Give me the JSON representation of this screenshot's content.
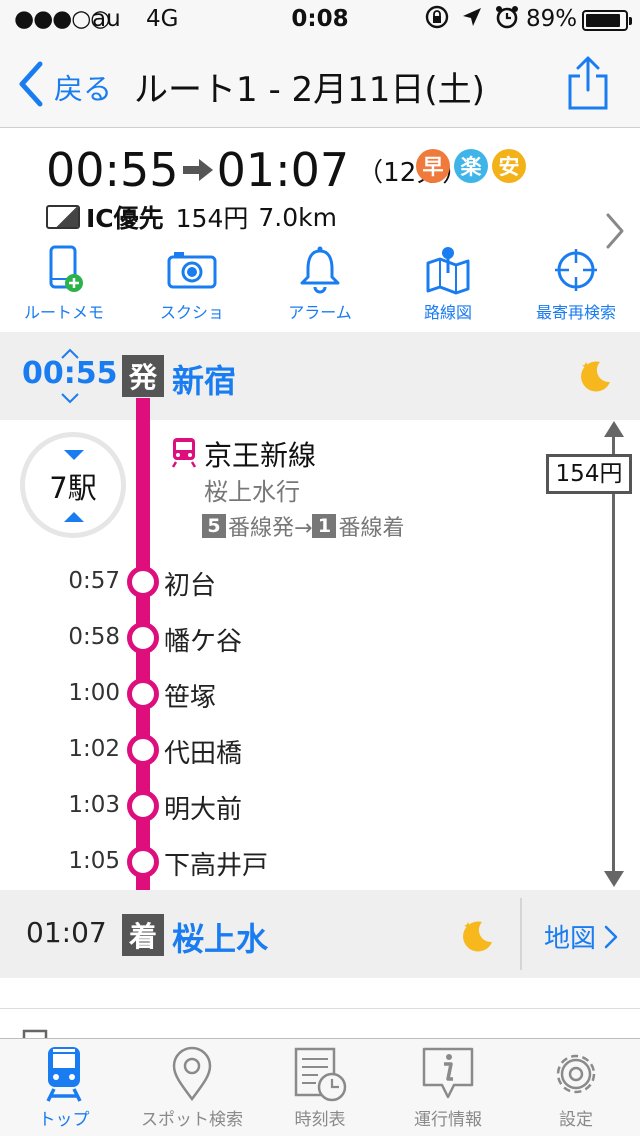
{
  "status_bar": {
    "signal": "●●●○○",
    "carrier": "au",
    "network": "4G",
    "time": "0:08",
    "battery_text": "89%",
    "battery_level": 0.89
  },
  "nav": {
    "back_label": "戻る",
    "title": "ルート1 - 2月11日(土)"
  },
  "summary": {
    "depart": "00:55",
    "arrive": "01:07",
    "duration": "（12分）",
    "badges": [
      {
        "label": "早",
        "color": "#f07a3c"
      },
      {
        "label": "楽",
        "color": "#3fb4e8"
      },
      {
        "label": "安",
        "color": "#f3b21a"
      }
    ],
    "ic_label": "IC優先",
    "fare": "154円",
    "distance": "7.0km"
  },
  "actions": [
    {
      "label": "ルートメモ",
      "icon": "phone-add-icon"
    },
    {
      "label": "スクショ",
      "icon": "camera-icon"
    },
    {
      "label": "アラーム",
      "icon": "bell-icon"
    },
    {
      "label": "路線図",
      "icon": "map-pin-icon"
    },
    {
      "label": "最寄再検索",
      "icon": "crosshair-icon"
    }
  ],
  "departure": {
    "time": "00:55",
    "kanji": "発",
    "station": "新宿"
  },
  "segment": {
    "stations_count": "7駅",
    "line_name": "京王新線",
    "destination": "桜上水行",
    "platform_from": "5",
    "platform_from_text": "番線発→",
    "platform_to": "1",
    "platform_to_text": "番線着",
    "fare": "154円",
    "stops": [
      {
        "time": "0:57",
        "name": "初台"
      },
      {
        "time": "0:58",
        "name": "幡ケ谷"
      },
      {
        "time": "1:00",
        "name": "笹塚"
      },
      {
        "time": "1:02",
        "name": "代田橋"
      },
      {
        "time": "1:03",
        "name": "明大前"
      },
      {
        "time": "1:05",
        "name": "下高井戸"
      }
    ]
  },
  "arrival": {
    "time": "01:07",
    "kanji": "着",
    "station": "桜上水",
    "map_label": "地図"
  },
  "tabs": [
    {
      "label": "トップ",
      "icon": "train-icon",
      "active": true
    },
    {
      "label": "スポット検索",
      "icon": "location-pin-icon",
      "active": false
    },
    {
      "label": "時刻表",
      "icon": "timetable-icon",
      "active": false
    },
    {
      "label": "運行情報",
      "icon": "info-icon",
      "active": false
    },
    {
      "label": "設定",
      "icon": "gear-icon",
      "active": false
    }
  ],
  "colors": {
    "accent": "#1a7cf1",
    "line": "#de0f7d",
    "moon": "#f6b81d"
  }
}
